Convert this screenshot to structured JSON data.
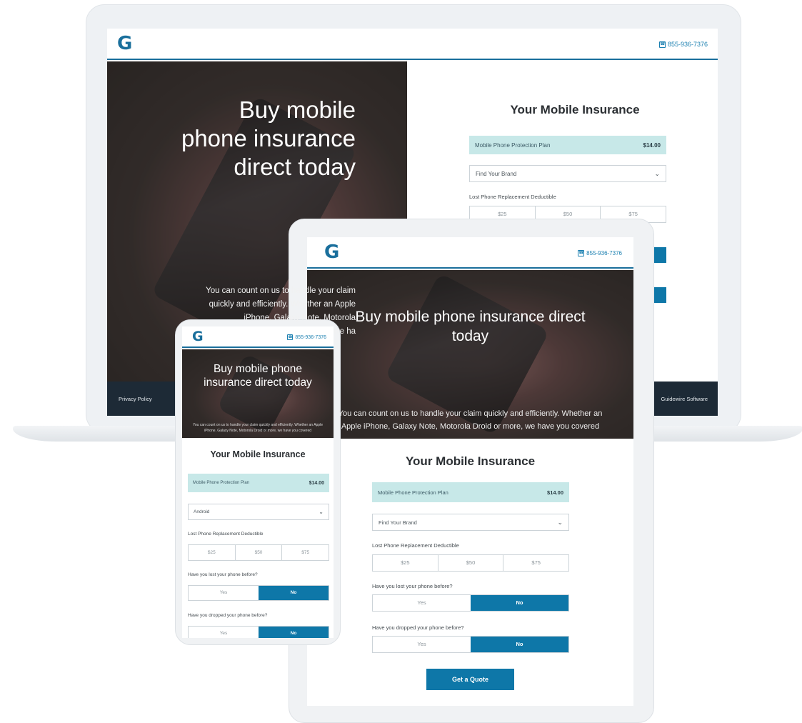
{
  "brand": {
    "logo_glyph": "G",
    "phone": "855-936-7376",
    "accent": "#0e77a8",
    "plan_bg": "#c7e8e8"
  },
  "hero": {
    "title_laptop_lines": [
      "Buy mobile",
      "phone insurance",
      "direct today"
    ],
    "title": "Buy mobile phone insurance direct today",
    "body_laptop_lines": [
      "You can count on us to handle your claim",
      "quickly and efficiently. Whether an Apple",
      "iPhone, Galaxy Note, Motorola",
      "we ha"
    ],
    "body": "You can count on us to handle your claim quickly and efficiently. Whether an Apple iPhone, Galaxy Note, Motorola Droid or more, we have you covered"
  },
  "card": {
    "title": "Your Mobile Insurance",
    "plan_label": "Mobile Phone Protection Plan",
    "plan_price": "$14.00",
    "brand_placeholder": "Find Your Brand",
    "brand_selected_phone": "Android",
    "deductible_label": "Lost Phone Replacement Deductible",
    "deductibles": [
      "$25",
      "$50",
      "$75"
    ],
    "q_lost": "Have you lost your phone before?",
    "q_dropped": "Have you dropped your phone before?",
    "yes": "Yes",
    "no": "No",
    "cta": "Get a Quote"
  },
  "footer": {
    "privacy": "Privacy Policy",
    "company": "Guidewire Software"
  }
}
